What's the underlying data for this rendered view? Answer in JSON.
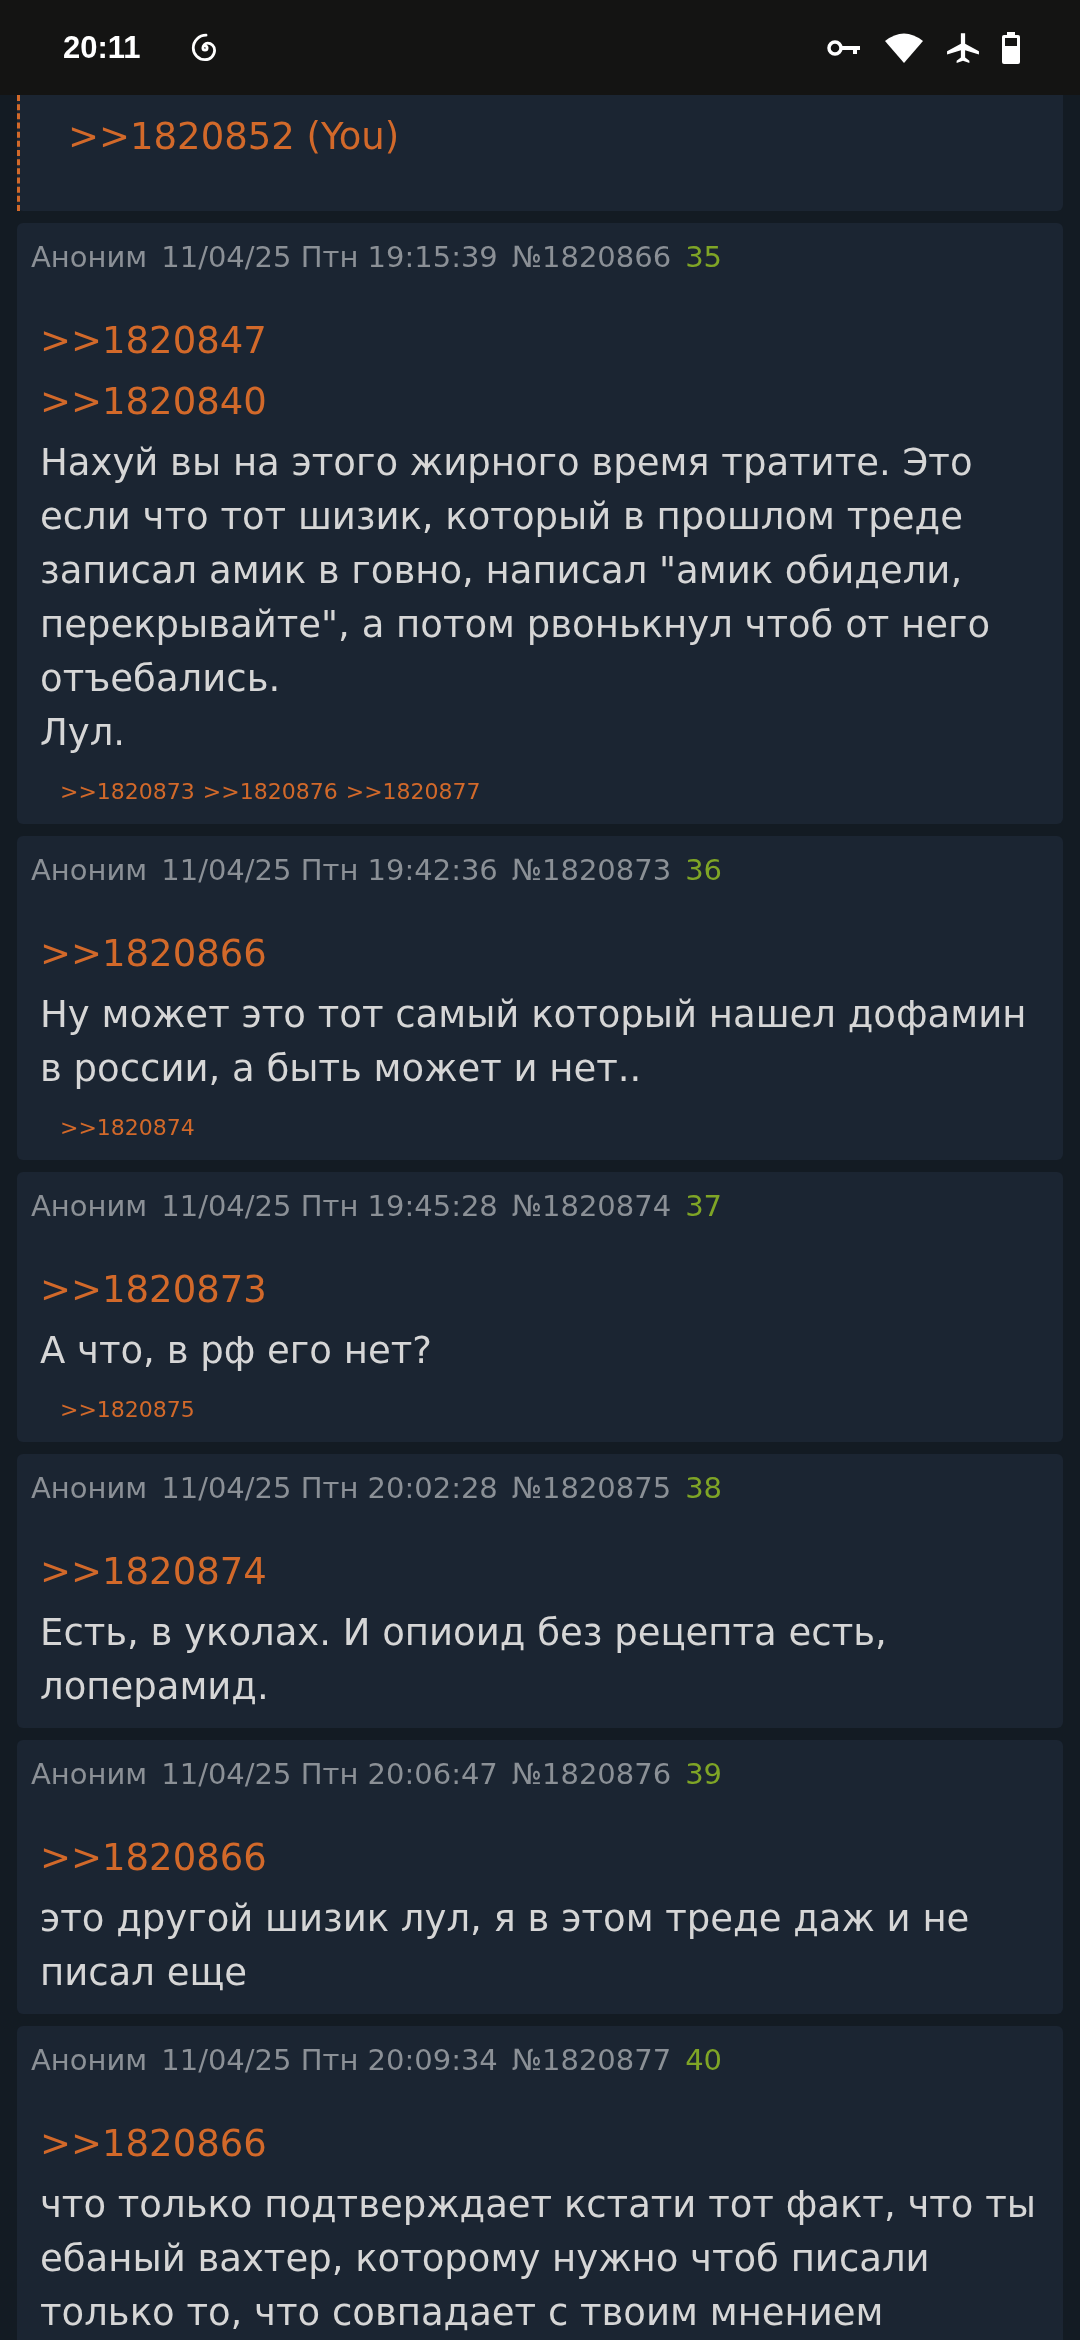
{
  "status_bar": {
    "time": "20:11"
  },
  "partial_post": {
    "reply_link": ">>1820852 (You)"
  },
  "posts": [
    {
      "author": "Аноним",
      "date": "11/04/25 Птн 19:15:39",
      "number": "№1820866",
      "index": "35",
      "reply_links": [
        ">>1820847",
        ">>1820840"
      ],
      "body": [
        "Нахуй вы на этого жирного время тратите. Это если что тот шизик, который в прошлом треде записал амик в говно, написал \"амик обидели, перекрывайте\", а потом рвонькнул чтоб от него отъебались.",
        "Лул."
      ],
      "backlinks": [
        ">>1820873",
        ">>1820876",
        ">>1820877"
      ]
    },
    {
      "author": "Аноним",
      "date": "11/04/25 Птн 19:42:36",
      "number": "№1820873",
      "index": "36",
      "reply_links": [
        ">>1820866"
      ],
      "body": [
        "Ну может это тот самый который нашел дофамин в россии, а быть может и нет.."
      ],
      "backlinks": [
        ">>1820874"
      ]
    },
    {
      "author": "Аноним",
      "date": "11/04/25 Птн 19:45:28",
      "number": "№1820874",
      "index": "37",
      "reply_links": [
        ">>1820873"
      ],
      "body": [
        "А что, в рф его нет?"
      ],
      "backlinks": [
        ">>1820875"
      ]
    },
    {
      "author": "Аноним",
      "date": "11/04/25 Птн 20:02:28",
      "number": "№1820875",
      "index": "38",
      "reply_links": [
        ">>1820874"
      ],
      "body": [
        "Есть, в уколах. И опиоид без рецепта есть, лоперамид."
      ]
    },
    {
      "author": "Аноним",
      "date": "11/04/25 Птн 20:06:47",
      "number": "№1820876",
      "index": "39",
      "reply_links": [
        ">>1820866"
      ],
      "body": [
        "это другой шизик лул, я в этом треде даж и не писал еще"
      ]
    },
    {
      "author": "Аноним",
      "date": "11/04/25 Птн 20:09:34",
      "number": "№1820877",
      "index": "40",
      "reply_links": [
        ">>1820866"
      ],
      "body": [
        "что только подтверждает кстати тот факт, что ты ебаный вахтер, которому нужно чтоб писали только то, что совпадает с твоим мнением"
      ]
    }
  ]
}
